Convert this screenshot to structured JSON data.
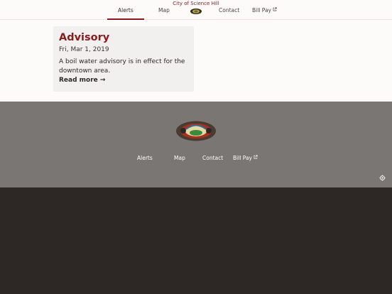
{
  "site": {
    "title": "City of Science Hill"
  },
  "nav": {
    "alerts": "Alerts",
    "map": "Map",
    "contact": "Contact",
    "bill_pay": "Bill Pay"
  },
  "alert": {
    "title": "Advisory",
    "date": "Fri, Mar 1, 2019",
    "body": "A boil water advisory is in effect for the downtown area.",
    "read_more": "Read more →"
  },
  "footer": {
    "alerts": "Alerts",
    "map": "Map",
    "contact": "Contact",
    "bill_pay": "Bill Pay"
  },
  "colors": {
    "brand": "#8b1a1e",
    "page_bg": "#fcfbfa",
    "card_bg": "#f2f0ee",
    "footer_bg": "#7a7673",
    "dark_bg": "#2d2825"
  },
  "icons": {
    "external": "external-link-icon",
    "logo": "city-seal-logo",
    "settings": "gear-icon"
  }
}
